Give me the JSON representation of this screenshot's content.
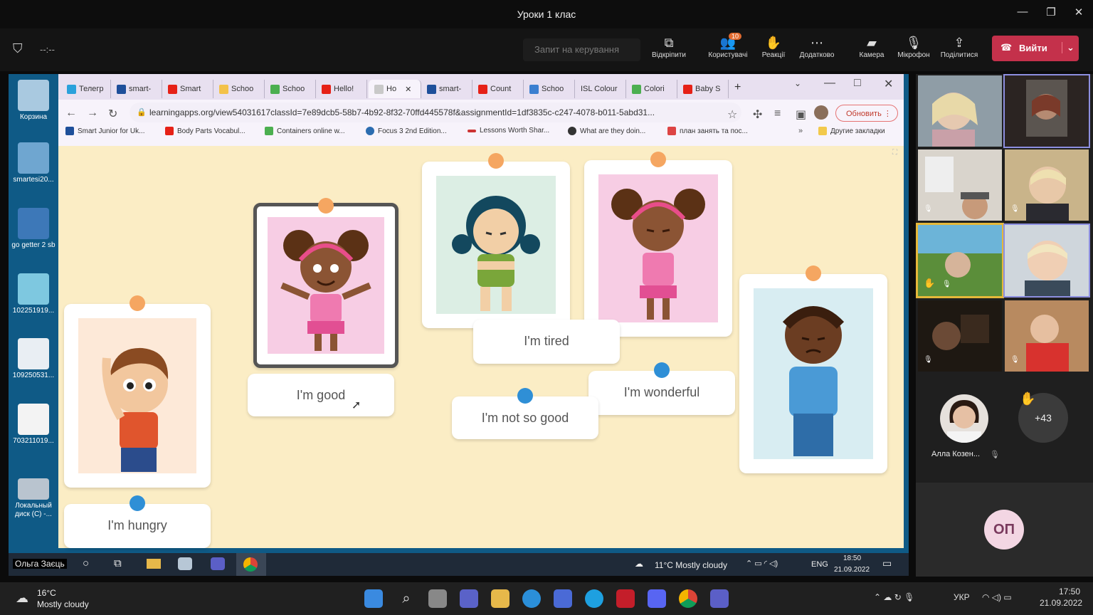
{
  "window": {
    "title": "Уроки 1 клас"
  },
  "meeting": {
    "control_request": "Запит на керування",
    "buttons": {
      "pin": "Відкріпити",
      "users": "Користувачі",
      "users_badge": "10",
      "reactions": "Реакції",
      "more": "Додатково",
      "camera": "Камера",
      "mic": "Мікрофон",
      "share": "Поділитися"
    },
    "leave": "Вийти",
    "timer": "--:--"
  },
  "desktop": {
    "icons": [
      "Корзина",
      "smartesi20...",
      "go getter 2 sb",
      "102251919...",
      "109250531...",
      "703211019...",
      "Локальный диск (C) -..."
    ]
  },
  "browser": {
    "tabs": [
      "Телегр",
      "smart-",
      "Smart",
      "Schoo",
      "Schoo",
      "Hello!",
      "Ho",
      "smart-",
      "Count",
      "Schoo",
      "ISL Colour",
      "Colori",
      "Baby S"
    ],
    "address": "learningapps.org/view54031617classId=7e89dcb5-58b7-4b92-8f32-70ffd445578f&assignmentId=1df3835c-c247-4078-b011-5abd31...",
    "update_button": "Обновить",
    "bookmarks": [
      "Smart Junior for Uk...",
      "Body Parts Vocabul...",
      "Containers online w...",
      "Focus 3 2nd Edition...",
      "Lessons Worth Shar...",
      "What are they doin...",
      "план занять та пос..."
    ],
    "other_bookmarks": "Другие закладки"
  },
  "activity": {
    "labels": {
      "good": "I'm good",
      "tired": "I'm tired",
      "wonderful": "I'm wonderful",
      "not_so_good": "I'm not so good",
      "hungry": "I'm hungry"
    }
  },
  "inner_taskbar": {
    "presenter": "Ольга Заєць",
    "weather": "11°C  Mostly cloudy",
    "lang": "ENG",
    "time": "18:50",
    "date": "21.09.2022"
  },
  "participants": {
    "name": "Алла Козен...",
    "more": "+43",
    "initials": "ОП"
  },
  "os_taskbar": {
    "temp": "16°C",
    "weather": "Mostly cloudy",
    "lang": "УКР",
    "time": "17:50",
    "date": "21.09.2022"
  }
}
